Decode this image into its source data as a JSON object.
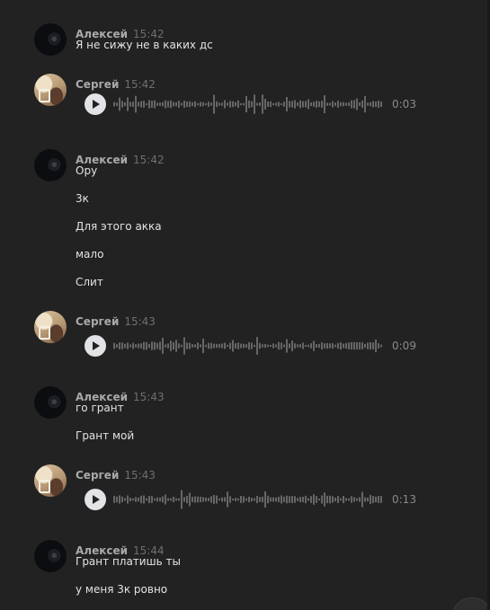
{
  "messages": [
    {
      "author": "Алексей",
      "avatar": "alexey",
      "time": "15:42",
      "lines": [
        "Я не сижу не в каких дс"
      ]
    },
    {
      "author": "Сергей",
      "avatar": "sergey",
      "time": "15:42",
      "voice": {
        "duration": "0:03",
        "played": 0
      }
    },
    {
      "author": "Алексей",
      "avatar": "alexey",
      "time": "15:42",
      "lines": [
        "Ору",
        "3к",
        "Для этого акка",
        "мало",
        "Слит"
      ]
    },
    {
      "author": "Сергей",
      "avatar": "sergey",
      "time": "15:43",
      "voice": {
        "duration": "0:09",
        "played": 0
      }
    },
    {
      "author": "Алексей",
      "avatar": "alexey",
      "time": "15:43",
      "lines": [
        "го грант",
        "Грант мой"
      ]
    },
    {
      "author": "Сергей",
      "avatar": "sergey",
      "time": "15:43",
      "voice": {
        "duration": "0:13",
        "played": 0
      }
    },
    {
      "author": "Алексей",
      "avatar": "alexey",
      "time": "15:44",
      "lines": [
        "Грант платишь ты",
        "у меня 3к ровно"
      ]
    }
  ],
  "colors": {
    "background": "#222222",
    "author": "#a9a9a9",
    "time": "#6f6f6f",
    "text": "#e1e3e6",
    "waveform": "#8c8c8c",
    "play_button": "#e1e3e6"
  },
  "icons": {
    "play": "play-icon",
    "scroll_down": "arrow-down-icon"
  }
}
